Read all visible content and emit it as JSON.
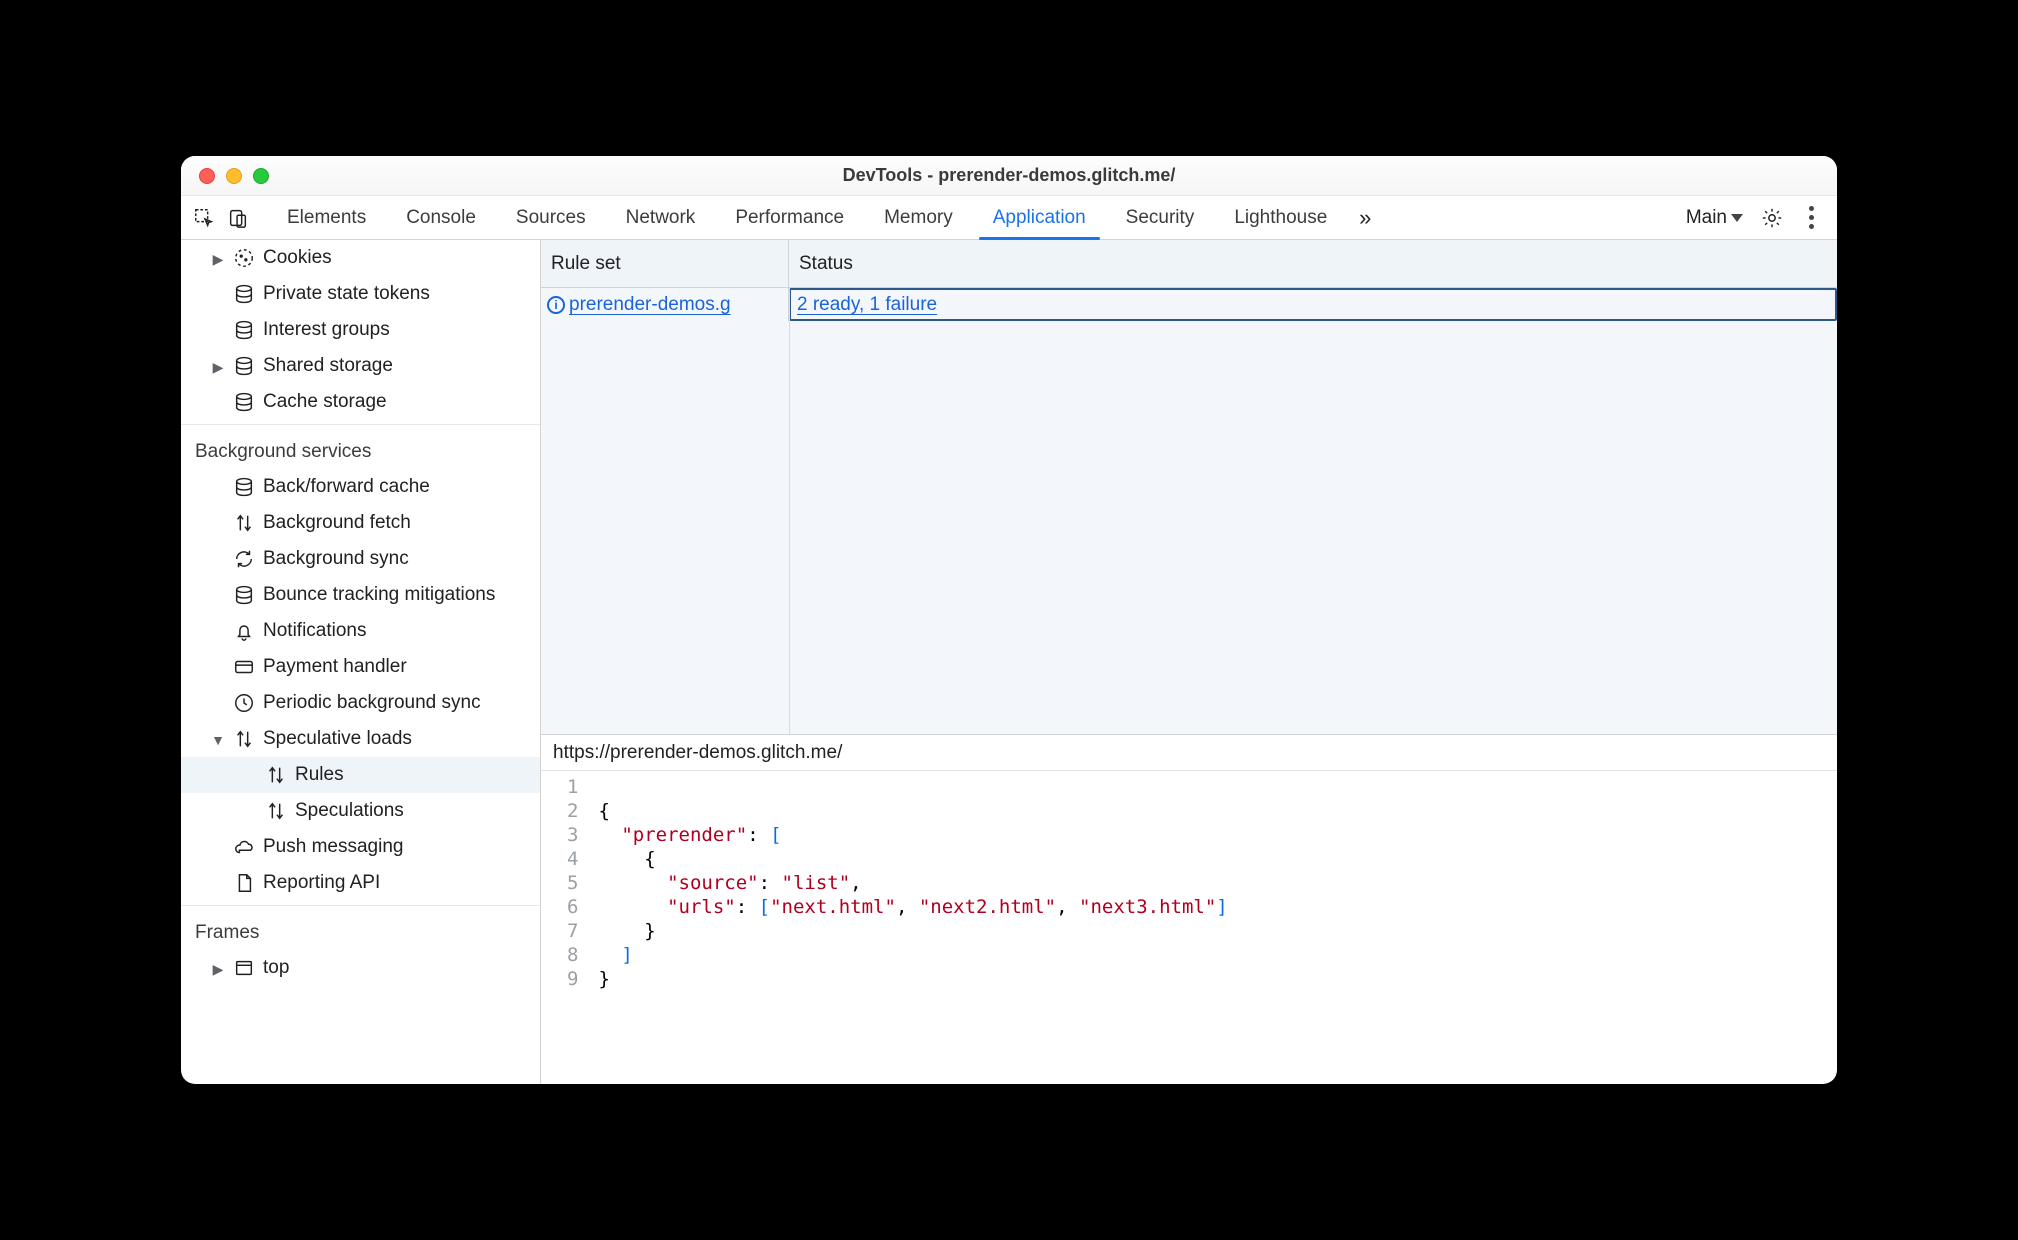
{
  "window": {
    "title": "DevTools - prerender-demos.glitch.me/"
  },
  "toolbar": {
    "tabs": [
      "Elements",
      "Console",
      "Sources",
      "Network",
      "Performance",
      "Memory",
      "Application",
      "Security",
      "Lighthouse"
    ],
    "active_tab_index": 6,
    "target_dropdown": "Main"
  },
  "sidebar": {
    "storage_items": [
      {
        "label": "Cookies",
        "icon": "cookie",
        "indent": "l1",
        "twist": "right"
      },
      {
        "label": "Private state tokens",
        "icon": "db",
        "indent": "l1"
      },
      {
        "label": "Interest groups",
        "icon": "db",
        "indent": "l1"
      },
      {
        "label": "Shared storage",
        "icon": "db",
        "indent": "l1",
        "twist": "right"
      },
      {
        "label": "Cache storage",
        "icon": "db",
        "indent": "l1"
      }
    ],
    "bg_title": "Background services",
    "bg_items": [
      {
        "label": "Back/forward cache",
        "icon": "db",
        "indent": "l1"
      },
      {
        "label": "Background fetch",
        "icon": "updown",
        "indent": "l1"
      },
      {
        "label": "Background sync",
        "icon": "sync",
        "indent": "l1"
      },
      {
        "label": "Bounce tracking mitigations",
        "icon": "db",
        "indent": "l1"
      },
      {
        "label": "Notifications",
        "icon": "bell",
        "indent": "l1"
      },
      {
        "label": "Payment handler",
        "icon": "card",
        "indent": "l1"
      },
      {
        "label": "Periodic background sync",
        "icon": "clock",
        "indent": "l1"
      },
      {
        "label": "Speculative loads",
        "icon": "updown",
        "indent": "l1",
        "twist": "down"
      },
      {
        "label": "Rules",
        "icon": "updown",
        "indent": "l3",
        "selected": true
      },
      {
        "label": "Speculations",
        "icon": "updown",
        "indent": "l3"
      },
      {
        "label": "Push messaging",
        "icon": "cloud",
        "indent": "l1"
      },
      {
        "label": "Reporting API",
        "icon": "doc",
        "indent": "l1"
      }
    ],
    "frames_title": "Frames",
    "frames": [
      {
        "label": "top",
        "icon": "frame",
        "indent": "l1",
        "twist": "right"
      }
    ]
  },
  "rules_table": {
    "headers": {
      "ruleset": "Rule set",
      "status": "Status"
    },
    "row": {
      "ruleset_text": " prerender-demos.g",
      "status_text": "2 ready, 1 failure"
    }
  },
  "source": {
    "url": "https://prerender-demos.glitch.me/",
    "lines": [
      "1",
      "2",
      "3",
      "4",
      "5",
      "6",
      "7",
      "8",
      "9"
    ],
    "json": {
      "prerender": [
        {
          "source": "list",
          "urls": [
            "next.html",
            "next2.html",
            "next3.html"
          ]
        }
      ]
    }
  }
}
